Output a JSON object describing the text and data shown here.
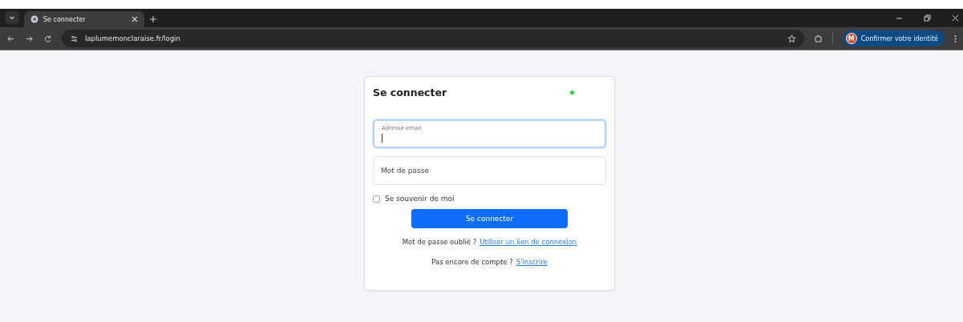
{
  "browser": {
    "tabs": [
      {
        "title": "Se connecter",
        "selected": true
      }
    ],
    "url": "laplumemonclaraise.fr/login",
    "profile_button": {
      "initial": "M",
      "label": "Confirmer votre identité"
    }
  },
  "login_card": {
    "title": "Se connecter",
    "status_dot": {
      "color": "#22dd22"
    },
    "email_field": {
      "label": "Adresse email",
      "focused": true
    },
    "password_field": {
      "placeholder": "Mot de passe"
    },
    "remember": {
      "label": "Se souvenir de moi",
      "checked": false
    },
    "submit": "Se connecter",
    "links": [
      {
        "text": "Mot de passe oublié ?",
        "link": "Utiliser un lien de connexion"
      },
      {
        "text": "Pas encore de compte ?",
        "link": "S'inscrire"
      }
    ]
  }
}
